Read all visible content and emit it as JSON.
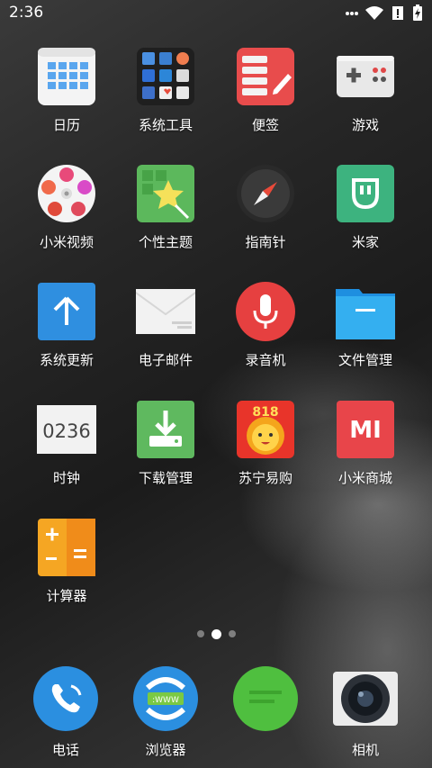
{
  "status_bar": {
    "time": "2:36"
  },
  "apps": [
    {
      "label": "日历"
    },
    {
      "label": "系统工具"
    },
    {
      "label": "便签"
    },
    {
      "label": "游戏"
    },
    {
      "label": "小米视频"
    },
    {
      "label": "个性主题"
    },
    {
      "label": "指南针"
    },
    {
      "label": "米家"
    },
    {
      "label": "系统更新"
    },
    {
      "label": "电子邮件"
    },
    {
      "label": "录音机"
    },
    {
      "label": "文件管理"
    },
    {
      "label": "时钟",
      "clock_text": "0236"
    },
    {
      "label": "下载管理"
    },
    {
      "label": "苏宁易购",
      "badge_text": "818"
    },
    {
      "label": "小米商城",
      "logo_text": "MI"
    },
    {
      "label": "计算器"
    }
  ],
  "pager": {
    "pages": 3,
    "current": 2
  },
  "dock": [
    {
      "label": "电话"
    },
    {
      "label": "浏览器",
      "icon_text": ":WWW"
    },
    {
      "label": ""
    },
    {
      "label": "相机"
    }
  ]
}
